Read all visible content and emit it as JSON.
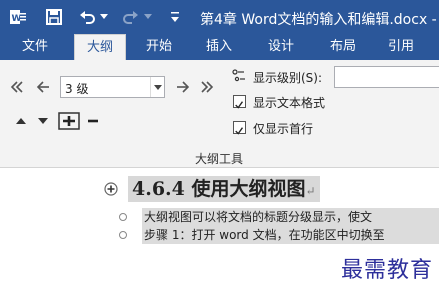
{
  "window": {
    "title": "第4章 Word文档的输入和编辑.docx -"
  },
  "tabs": [
    {
      "label": "文件",
      "active": false
    },
    {
      "label": "大纲",
      "active": true
    },
    {
      "label": "开始",
      "active": false
    },
    {
      "label": "插入",
      "active": false
    },
    {
      "label": "设计",
      "active": false
    },
    {
      "label": "布局",
      "active": false
    },
    {
      "label": "引用",
      "active": false
    }
  ],
  "ribbon": {
    "level_select_value": "3 级",
    "show_level_label": "显示级别(S):",
    "show_level_value": "",
    "show_text_format_label": "显示文本格式",
    "show_text_format_checked": true,
    "show_first_line_only_label": "仅显示首行",
    "show_first_line_only_checked": true,
    "group_label": "大纲工具"
  },
  "document": {
    "heading": "4.6.4  使用大纲视图",
    "paragraphs": [
      "大纲视图可以将文档的标题分级显示，使文",
      "步骤 1：打开 word 文档，在功能区中切换至"
    ]
  },
  "watermark": "最需教育",
  "colors": {
    "accent": "#2b579a",
    "ribbon_bg": "#f3f3f3",
    "watermark": "#2d2f9b"
  }
}
